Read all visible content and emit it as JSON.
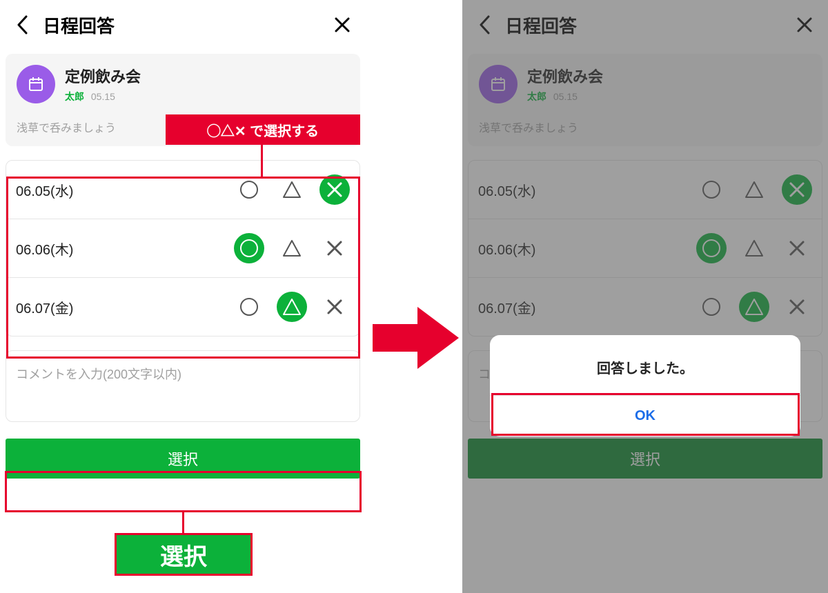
{
  "header": {
    "title": "日程回答"
  },
  "event": {
    "title": "定例飲み会",
    "author": "太郎",
    "date": "05.15",
    "description": "浅草で呑みましょう"
  },
  "dates": [
    {
      "label": "06.05(水)",
      "selected": "x"
    },
    {
      "label": "06.06(木)",
      "selected": "o"
    },
    {
      "label": "06.07(金)",
      "selected": "t"
    }
  ],
  "comment": {
    "placeholder": "コメントを入力(200文字以内)"
  },
  "buttons": {
    "select": "選択"
  },
  "annotations": {
    "hint": "◯△✕ で選択する",
    "select_callout": "選択"
  },
  "alert": {
    "message": "回答しました。",
    "ok": "OK"
  }
}
